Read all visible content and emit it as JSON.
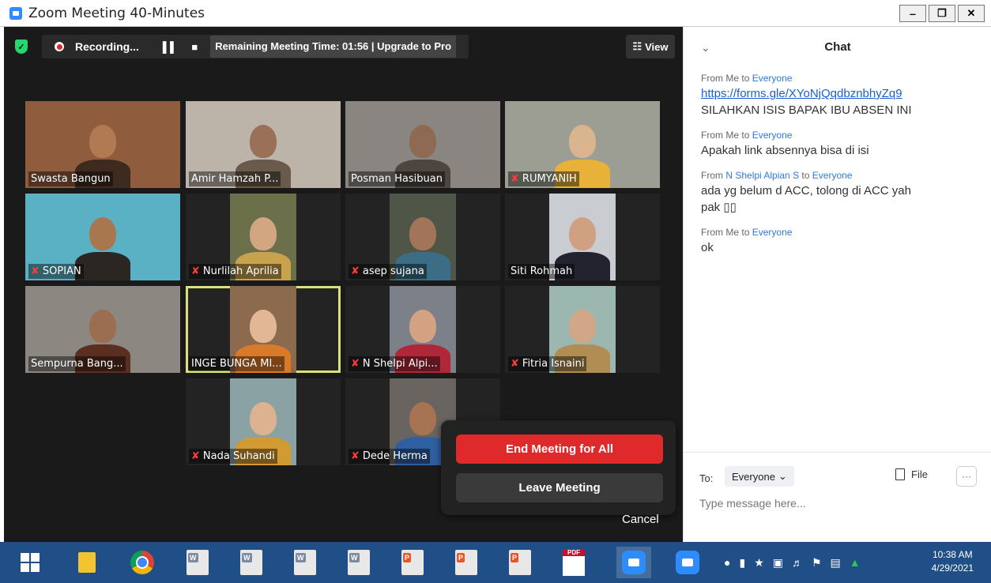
{
  "window": {
    "title": "Zoom Meeting 40-Minutes",
    "minimize": "‒",
    "restore": "❐",
    "close": "✕"
  },
  "topbar": {
    "recording_label": "Recording...",
    "pause_icon": "▌▌",
    "stop_icon": "■",
    "remaining_text": "Remaining Meeting Time: 01:56 | Upgrade to Pro",
    "view_label": "View",
    "view_icon": "☷",
    "shield_icon": "✓"
  },
  "participants": [
    {
      "name": "Swasta Bangun",
      "muted": false,
      "bg": "#8f5d3e",
      "skin": "#b27a52",
      "shirt": "#3f2a20"
    },
    {
      "name": "Amir Hamzah P...",
      "muted": false,
      "bg": "#bdb4a9",
      "skin": "#9b7059",
      "shirt": "#6a5a4c"
    },
    {
      "name": "Posman Hasibuan",
      "muted": false,
      "bg": "#8a8580",
      "skin": "#8e6a52",
      "shirt": "#4d4640"
    },
    {
      "name": "RUMYANIH",
      "muted": true,
      "bg": "#9c9e94",
      "skin": "#d9b48e",
      "shirt": "#e8b13a"
    },
    {
      "name": "SOPIAN",
      "muted": true,
      "bg": "#5ab1c4",
      "skin": "#a8764f",
      "shirt": "#2c2622"
    },
    {
      "name": "Nurlilah Aprilia",
      "muted": true,
      "bg": "#6b6f4a",
      "skin": "#d3a682",
      "shirt": "#c9a24d"
    },
    {
      "name": "asep sujana",
      "muted": true,
      "bg": "#4f5648",
      "skin": "#a2755a",
      "shirt": "#3c6d86"
    },
    {
      "name": "Siti Rohmah",
      "muted": false,
      "bg": "#c9cdd1",
      "skin": "#cfa182",
      "shirt": "#232330"
    },
    {
      "name": "Sempurna Bang...",
      "muted": false,
      "bg": "#8c8881",
      "skin": "#9b6d51",
      "shirt": "#5a2f22"
    },
    {
      "name": "INGE BUNGA MI...",
      "muted": false,
      "bg": "#8b6a4e",
      "skin": "#e2b795",
      "shirt": "#d97a2a"
    },
    {
      "name": "N Shelpi Alpi...",
      "muted": true,
      "bg": "#7c8088",
      "skin": "#d2a283",
      "shirt": "#b0273a"
    },
    {
      "name": "Fitria Isnaini",
      "muted": true,
      "bg": "#9bb7b0",
      "skin": "#d1a787",
      "shirt": "#b08d52"
    },
    {
      "name": "Nada Suhandi",
      "muted": true,
      "bg": "#8aa2a4",
      "skin": "#dcb291",
      "shirt": "#d19a32"
    },
    {
      "name": "Dede Herma",
      "muted": true,
      "bg": "#6a6460",
      "skin": "#a67453",
      "shirt": "#2e5fa0"
    }
  ],
  "muted_icon": "✘",
  "popup": {
    "end_all": "End Meeting for All",
    "leave": "Leave Meeting",
    "cancel": "Cancel"
  },
  "chat": {
    "title": "Chat",
    "collapse_icon": "⌄",
    "messages": [
      {
        "from": "Me",
        "to": "Everyone",
        "lines": [
          "https://forms.gle/XYoNjQqdbznbhyZq9",
          "SILAHKAN ISIS BAPAK IBU ABSEN INI"
        ]
      },
      {
        "from": "Me",
        "to": "Everyone",
        "lines": [
          "Apakah link absennya bisa di isi"
        ]
      },
      {
        "from": "N Shelpi Alpian S",
        "to": "Everyone",
        "lines": [
          "ada yg belum d ACC, tolong di ACC yah",
          "pak ▯▯"
        ]
      },
      {
        "from": "Me",
        "to": "Everyone",
        "lines": [
          "ok"
        ]
      }
    ],
    "from_word": "From",
    "to_word": "to",
    "to_label": "To:",
    "recipient": "Everyone",
    "recipient_chevron": "⌄",
    "file_label": "File",
    "more_label": "···",
    "placeholder": "Type message here..."
  },
  "taskbar": {
    "time": "10:38 AM",
    "date": "4/29/2021",
    "word_tag": "W",
    "ppt_tag": "P",
    "pdf_tag": "PDF"
  }
}
